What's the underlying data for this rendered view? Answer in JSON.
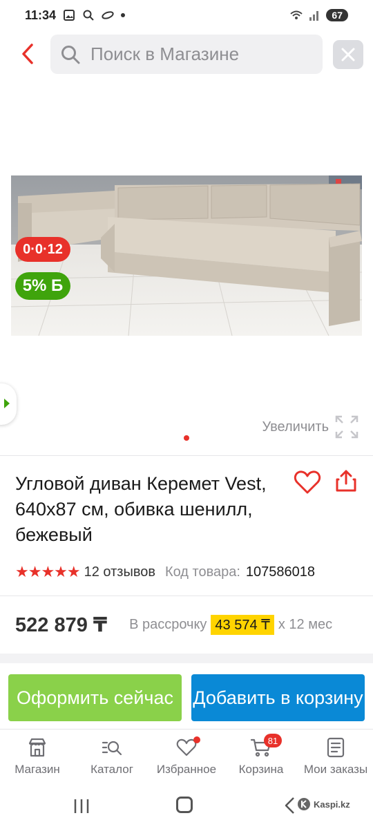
{
  "status_bar": {
    "time": "11:34",
    "battery": "67"
  },
  "search": {
    "placeholder": "Поиск в Магазине"
  },
  "gallery": {
    "installment_badge": "0·0·12",
    "bonus_badge": "5% Б",
    "zoom_label": "Увеличить"
  },
  "product": {
    "title": "Угловой диван Керемет Vest, 640x87 см, обивка шенилл, бежевый",
    "rating_stars": "★★★★★",
    "rating": 5,
    "reviews": "12 отзывов",
    "code_label": "Код товара:",
    "code_value": "107586018"
  },
  "price": {
    "value": "522 879 ₸",
    "installment_label": "В рассрочку",
    "installment_amount": "43 574 ₸",
    "installment_term": "x 12 мес"
  },
  "actions": {
    "buy_now": "Оформить сейчас",
    "add_to_cart": "Добавить в корзину"
  },
  "bottom_nav": {
    "shop": "Магазин",
    "catalog": "Каталог",
    "favorites": "Избранное",
    "cart": "Корзина",
    "cart_count": "81",
    "orders": "Мои заказы"
  },
  "brand": {
    "watermark": "Kaspi.kz"
  },
  "colors": {
    "accent_red": "#e8312a",
    "green": "#3fa40c",
    "buy_green": "#8ad14a",
    "cart_blue": "#0a89d6",
    "installment_yellow": "#ffd400"
  }
}
